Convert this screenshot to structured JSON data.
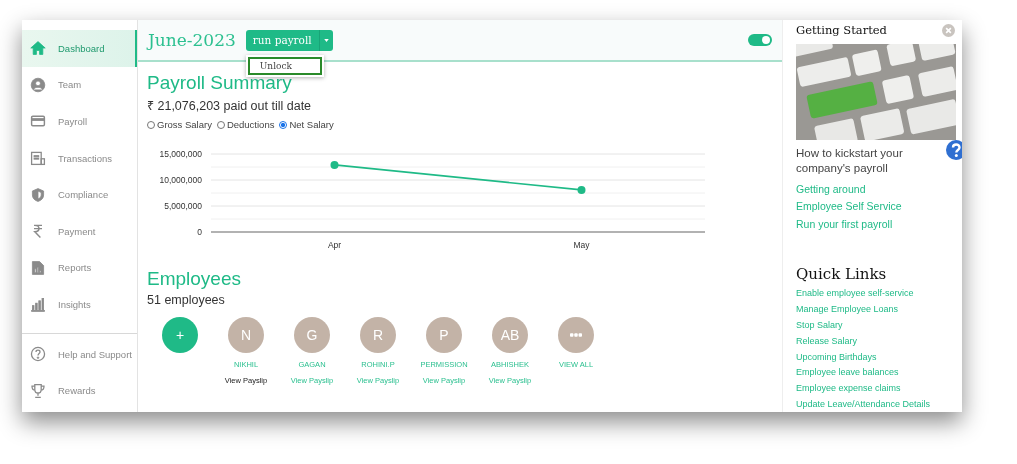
{
  "sidebar": {
    "items": [
      {
        "label": "Dashboard",
        "kind": "home",
        "selected": true
      },
      {
        "label": "Team",
        "kind": "person",
        "selected": false
      },
      {
        "label": "Payroll",
        "kind": "card",
        "selected": false
      },
      {
        "label": "Transactions",
        "kind": "receipt",
        "selected": false
      },
      {
        "label": "Compliance",
        "kind": "shield",
        "selected": false
      },
      {
        "label": "Payment",
        "kind": "rupee",
        "selected": false
      },
      {
        "label": "Reports",
        "kind": "report",
        "selected": false
      },
      {
        "label": "Insights",
        "kind": "bars",
        "selected": false
      }
    ],
    "footer_items": [
      {
        "label": "Help and Support",
        "kind": "help",
        "selected": false
      },
      {
        "label": "Rewards",
        "kind": "trophy",
        "selected": false
      }
    ]
  },
  "header": {
    "month": "June-2023",
    "run_button": "run payroll",
    "menu_open": true,
    "menu_items": [
      {
        "label": "Unlock",
        "selected": true
      }
    ],
    "toggle_on": true
  },
  "payroll_summary": {
    "title": "Payroll Summary",
    "total": "₹ 21,076,203 paid out till date",
    "options": [
      {
        "label": "Gross Salary",
        "selected": false
      },
      {
        "label": "Deductions",
        "selected": false
      },
      {
        "label": "Net Salary",
        "selected": true
      }
    ],
    "chart_data": {
      "type": "line",
      "categories": [
        "Apr",
        "May"
      ],
      "series": [
        {
          "color": "#1fba87",
          "marker": "circle",
          "values": [
            12900000,
            8100000
          ]
        }
      ],
      "ylim": [
        0,
        15000000
      ],
      "yticks": [
        {
          "value": 0,
          "label": "0"
        },
        {
          "value": 5000000,
          "label": "5,000,000"
        },
        {
          "value": 10000000,
          "label": "10,000,000"
        },
        {
          "value": 15000000,
          "label": "15,000,000"
        }
      ]
    }
  },
  "employees": {
    "title": "Employees",
    "count": "51 employees",
    "add_label": "+",
    "people": [
      {
        "initials": "N",
        "name": "NIKHIL",
        "link": "View Payslip",
        "active": true
      },
      {
        "initials": "G",
        "name": "GAGAN",
        "link": "View Payslip",
        "active": false
      },
      {
        "initials": "R",
        "name": "ROHINI.P",
        "link": "View Payslip",
        "active": false
      },
      {
        "initials": "P",
        "name": "PERMISSION",
        "link": "View Payslip",
        "active": false
      },
      {
        "initials": "AB",
        "name": "ABHISHEK",
        "link": "View Payslip",
        "active": false
      }
    ],
    "view_all": "VIEW ALL"
  },
  "getting_started": {
    "title": "Getting Started",
    "text": "How to kickstart your company's payroll",
    "links": [
      "Getting around",
      "Employee Self Service",
      "Run your first payroll"
    ]
  },
  "quick_links": {
    "title": "Quick Links",
    "links": [
      "Enable employee self-service",
      "Manage Employee Loans",
      "Stop Salary",
      "Release Salary",
      "Upcoming Birthdays",
      "Employee leave balances",
      "Employee expense claims",
      "Update Leave/Attendance Details"
    ]
  }
}
